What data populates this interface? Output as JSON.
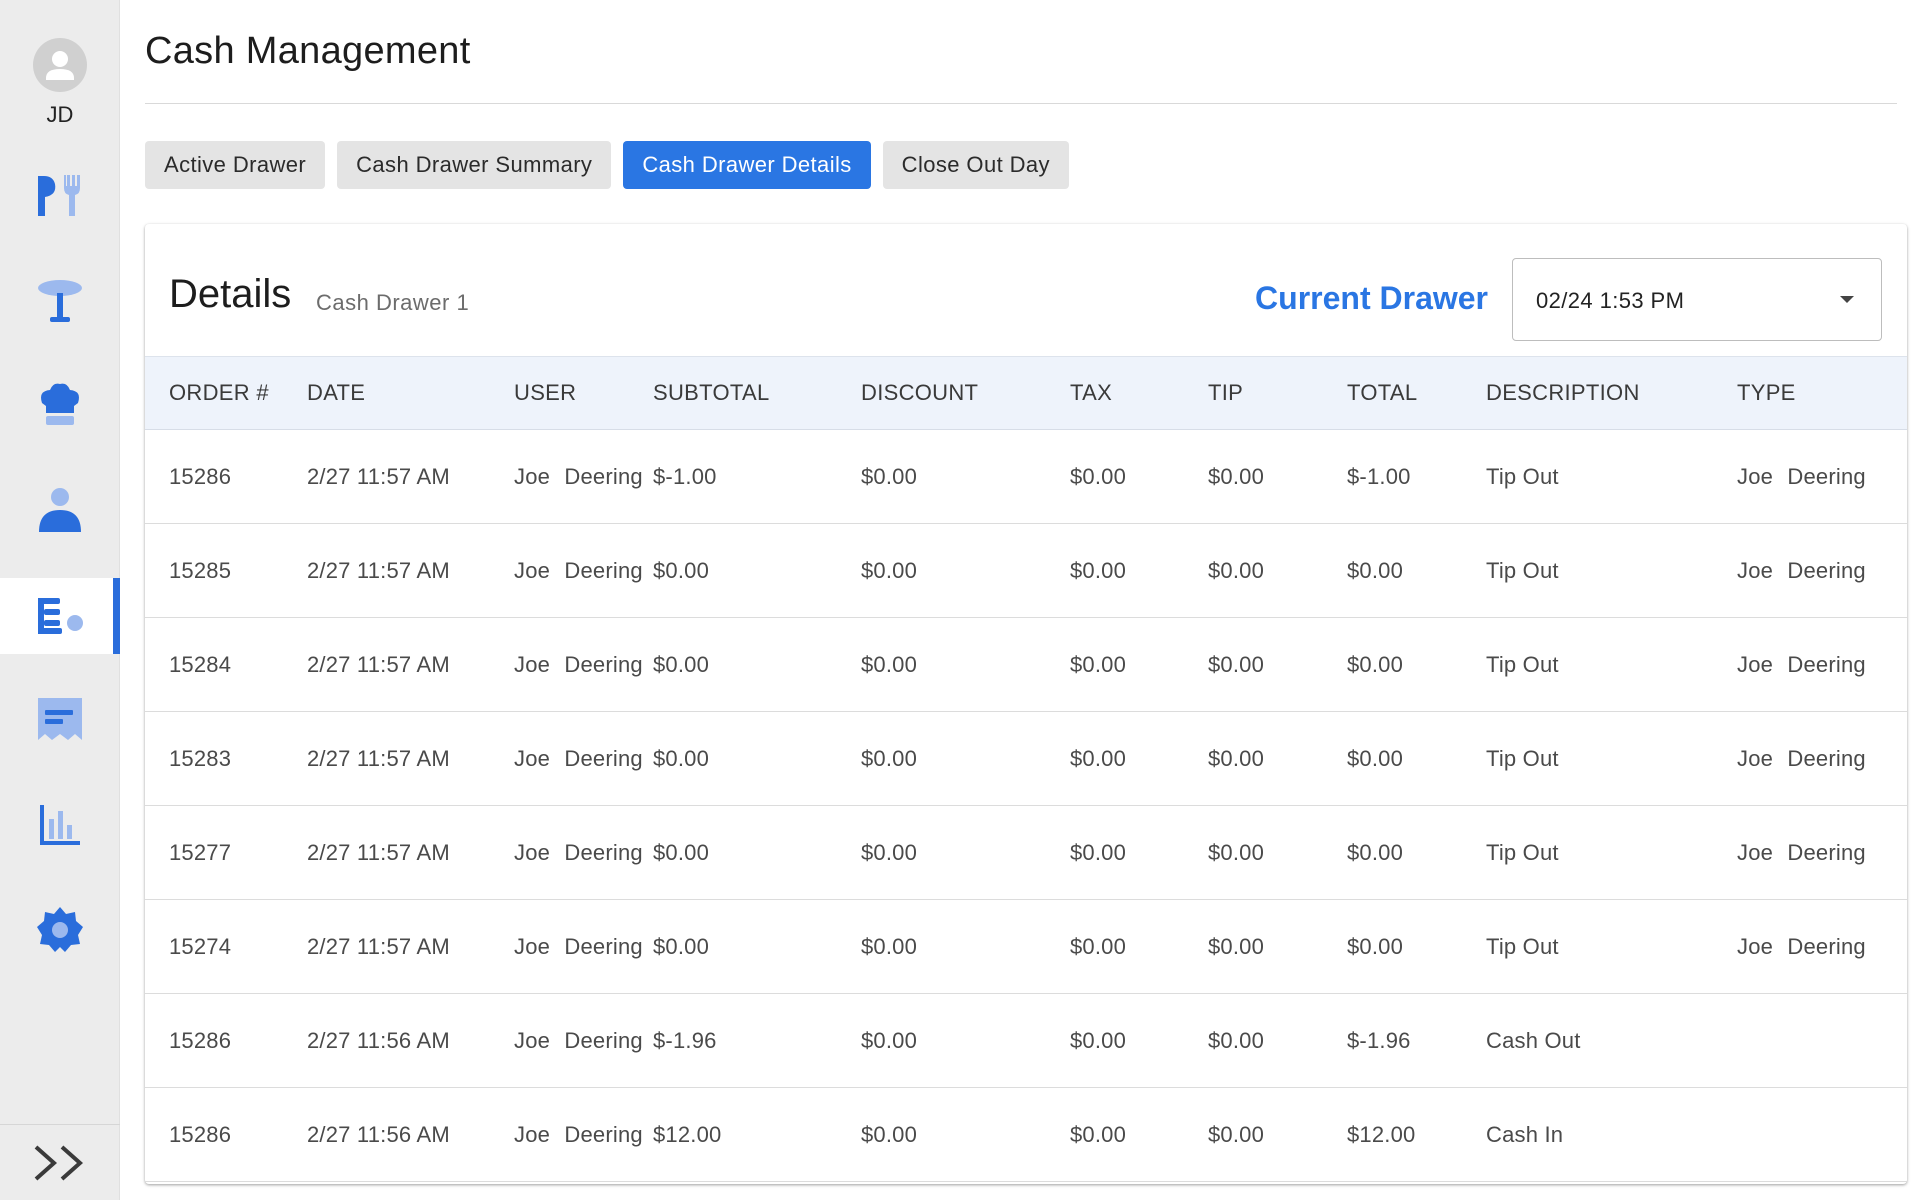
{
  "user": {
    "initials": "JD"
  },
  "sidebar": {
    "items": [
      {
        "icon": "utensils-icon",
        "label": "Menu"
      },
      {
        "icon": "table-icon",
        "label": "Tables"
      },
      {
        "icon": "chef-hat-icon",
        "label": "Kitchen"
      },
      {
        "icon": "person-icon",
        "label": "Employees"
      },
      {
        "icon": "cash-drawer-icon",
        "label": "Cash Management",
        "active": true
      },
      {
        "icon": "receipt-icon",
        "label": "Orders"
      },
      {
        "icon": "bar-chart-icon",
        "label": "Reports"
      },
      {
        "icon": "gear-icon",
        "label": "Settings"
      }
    ],
    "expand_icon": "double-chevron-right-icon"
  },
  "page": {
    "title": "Cash Management"
  },
  "tabs": [
    {
      "label": "Active Drawer"
    },
    {
      "label": "Cash Drawer Summary"
    },
    {
      "label": "Cash Drawer Details",
      "active": true
    },
    {
      "label": "Close Out Day"
    }
  ],
  "details": {
    "title": "Details",
    "subtitle": "Cash Drawer 1",
    "current_drawer_label": "Current Drawer",
    "drawer_select_value": "02/24 1:53 PM"
  },
  "table": {
    "headers": [
      "ORDER #",
      "DATE",
      "USER",
      "SUBTOTAL",
      "DISCOUNT",
      "TAX",
      "TIP",
      "TOTAL",
      "DESCRIPTION",
      "TYPE"
    ],
    "rows": [
      [
        "15286",
        "2/27 11:57 AM",
        "Joe Deering",
        "$-1.00",
        "$0.00",
        "$0.00",
        "$0.00",
        "$-1.00",
        "Tip Out",
        "Joe Deering"
      ],
      [
        "15285",
        "2/27 11:57 AM",
        "Joe Deering",
        "$0.00",
        "$0.00",
        "$0.00",
        "$0.00",
        "$0.00",
        "Tip Out",
        "Joe Deering"
      ],
      [
        "15284",
        "2/27 11:57 AM",
        "Joe Deering",
        "$0.00",
        "$0.00",
        "$0.00",
        "$0.00",
        "$0.00",
        "Tip Out",
        "Joe Deering"
      ],
      [
        "15283",
        "2/27 11:57 AM",
        "Joe Deering",
        "$0.00",
        "$0.00",
        "$0.00",
        "$0.00",
        "$0.00",
        "Tip Out",
        "Joe Deering"
      ],
      [
        "15277",
        "2/27 11:57 AM",
        "Joe Deering",
        "$0.00",
        "$0.00",
        "$0.00",
        "$0.00",
        "$0.00",
        "Tip Out",
        "Joe Deering"
      ],
      [
        "15274",
        "2/27 11:57 AM",
        "Joe Deering",
        "$0.00",
        "$0.00",
        "$0.00",
        "$0.00",
        "$0.00",
        "Tip Out",
        "Joe Deering"
      ],
      [
        "15286",
        "2/27 11:56 AM",
        "Joe Deering",
        "$-1.96",
        "$0.00",
        "$0.00",
        "$0.00",
        "$-1.96",
        "Cash Out",
        ""
      ],
      [
        "15286",
        "2/27 11:56 AM",
        "Joe Deering",
        "$12.00",
        "$0.00",
        "$0.00",
        "$0.00",
        "$12.00",
        "Cash In",
        ""
      ]
    ]
  },
  "colors": {
    "accent": "#2a76e3",
    "sidebar_bg": "#ececec",
    "icon_blue": "#2a6ddb",
    "icon_light": "#9cb9ee"
  }
}
